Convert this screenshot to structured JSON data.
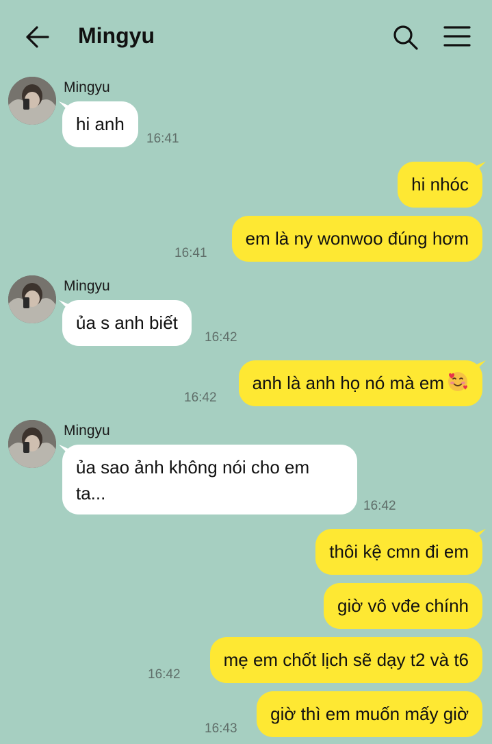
{
  "header": {
    "title": "Mingyu",
    "back_icon": "arrow-left-icon",
    "search_icon": "search-icon",
    "menu_icon": "hamburger-menu-icon"
  },
  "colors": {
    "background": "#a6cfc1",
    "incoming_bubble": "#ffffff",
    "outgoing_bubble": "#fee833",
    "timestamp": "#5f6e69"
  },
  "messages": [
    {
      "direction": "in",
      "sender": "Mingyu",
      "text": "hi anh",
      "time": "16:41"
    },
    {
      "direction": "out",
      "text": "hi nhóc",
      "time": ""
    },
    {
      "direction": "out",
      "text": "em là ny wonwoo đúng hơm",
      "time": "16:41"
    },
    {
      "direction": "in",
      "sender": "Mingyu",
      "text": "ủa s anh biết",
      "time": "16:42"
    },
    {
      "direction": "out",
      "text": "anh là anh họ nó mà em",
      "emoji": "smiling-face-with-hearts",
      "time": "16:42"
    },
    {
      "direction": "in",
      "sender": "Mingyu",
      "text": "ủa sao ảnh không nói cho em ta...",
      "time": "16:42"
    },
    {
      "direction": "out",
      "text": "thôi kệ cmn đi em",
      "time": ""
    },
    {
      "direction": "out",
      "text": "giờ vô vđe chính",
      "time": ""
    },
    {
      "direction": "out",
      "text": "mẹ em chốt lịch sẽ dạy t2 và t6",
      "time": "16:42"
    },
    {
      "direction": "out",
      "text": "giờ thì em muốn mấy giờ",
      "time": "16:43"
    }
  ]
}
